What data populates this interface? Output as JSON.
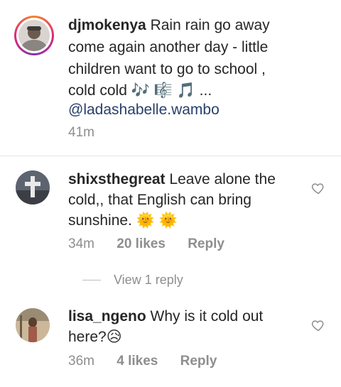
{
  "caption": {
    "username": "djmokenya",
    "text_line1": "Rain rain go away",
    "text_line2": "come again another day - little",
    "text_line3": "children want to go to school ,",
    "text_line4": "cold cold 🎶 🎼 🎵 ...",
    "mention": "@ladashabelle.wambo",
    "time": "41m"
  },
  "comments": [
    {
      "username": "shixsthegreat",
      "text_line1": "Leave alone the",
      "text_line2": "cold,, that English can bring",
      "text_line3": "sunshine. 🌞 🌞",
      "time": "34m",
      "likes": "20 likes",
      "reply": "Reply"
    },
    {
      "username": "lisa_ngeno",
      "text_line1": "Why is it cold out",
      "text_line2": "here?😥",
      "time": "36m",
      "likes": "4 likes",
      "reply": "Reply"
    }
  ],
  "view_replies": "View 1 reply",
  "icons": {
    "like": "heart-outline-icon"
  }
}
